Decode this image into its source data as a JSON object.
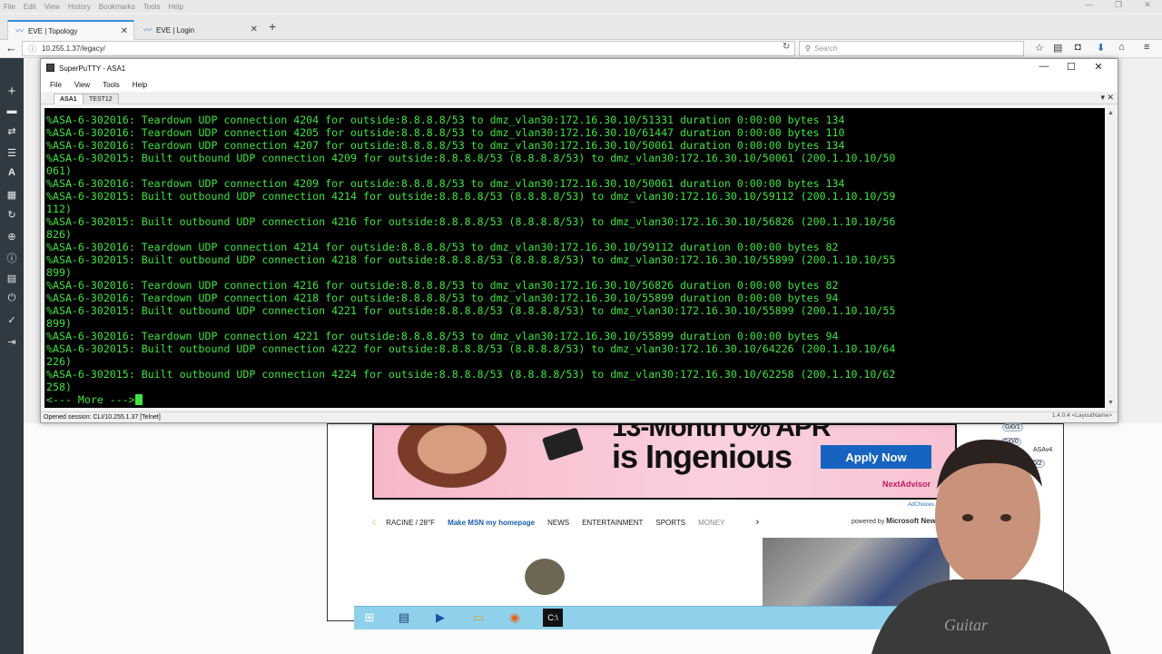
{
  "browser": {
    "menu": [
      "File",
      "Edit",
      "View",
      "History",
      "Bookmarks",
      "Tools",
      "Help"
    ],
    "tabs": [
      {
        "label": "EVE | Topology",
        "active": true
      },
      {
        "label": "EVE | Login",
        "active": false
      }
    ],
    "url": "10.255.1.37/legacy/",
    "search_placeholder": "Search",
    "accent": "#3b8bd6"
  },
  "sidebar": {
    "bg": "#2f3a42",
    "icons": [
      "plus-icon",
      "drive-icon",
      "shuffle-icon",
      "list-icon",
      "text-icon",
      "grid-icon",
      "refresh-icon",
      "zoom-icon",
      "list-alt-icon",
      "power-icon",
      "check-icon",
      "logout-icon"
    ]
  },
  "putty": {
    "title": "SuperPuTTY - ASA1",
    "menu": [
      "File",
      "View",
      "Tools",
      "Help"
    ],
    "tabs": [
      {
        "label": "ASA1",
        "active": true
      },
      {
        "label": "TEST12",
        "active": false
      }
    ],
    "terminal_color": "#3fe33f",
    "terminal_lines": [
      "%ASA-6-302016: Teardown UDP connection 4204 for outside:8.8.8.8/53 to dmz_vlan30:172.16.30.10/51331 duration 0:00:00 bytes 134",
      "%ASA-6-302016: Teardown UDP connection 4205 for outside:8.8.8.8/53 to dmz_vlan30:172.16.30.10/61447 duration 0:00:00 bytes 110",
      "%ASA-6-302016: Teardown UDP connection 4207 for outside:8.8.8.8/53 to dmz_vlan30:172.16.30.10/50061 duration 0:00:00 bytes 134",
      "%ASA-6-302015: Built outbound UDP connection 4209 for outside:8.8.8.8/53 (8.8.8.8/53) to dmz_vlan30:172.16.30.10/50061 (200.1.10.10/50",
      "061)",
      "%ASA-6-302016: Teardown UDP connection 4209 for outside:8.8.8.8/53 to dmz_vlan30:172.16.30.10/50061 duration 0:00:00 bytes 134",
      "%ASA-6-302015: Built outbound UDP connection 4214 for outside:8.8.8.8/53 (8.8.8.8/53) to dmz_vlan30:172.16.30.10/59112 (200.1.10.10/59",
      "112)",
      "%ASA-6-302015: Built outbound UDP connection 4216 for outside:8.8.8.8/53 (8.8.8.8/53) to dmz_vlan30:172.16.30.10/56826 (200.1.10.10/56",
      "826)",
      "%ASA-6-302016: Teardown UDP connection 4214 for outside:8.8.8.8/53 to dmz_vlan30:172.16.30.10/59112 duration 0:00:00 bytes 82",
      "%ASA-6-302015: Built outbound UDP connection 4218 for outside:8.8.8.8/53 (8.8.8.8/53) to dmz_vlan30:172.16.30.10/55899 (200.1.10.10/55",
      "899)",
      "%ASA-6-302016: Teardown UDP connection 4216 for outside:8.8.8.8/53 to dmz_vlan30:172.16.30.10/56826 duration 0:00:00 bytes 82",
      "%ASA-6-302016: Teardown UDP connection 4218 for outside:8.8.8.8/53 to dmz_vlan30:172.16.30.10/55899 duration 0:00:00 bytes 94",
      "%ASA-6-302015: Built outbound UDP connection 4221 for outside:8.8.8.8/53 (8.8.8.8/53) to dmz_vlan30:172.16.30.10/55899 (200.1.10.10/55",
      "899)",
      "%ASA-6-302016: Teardown UDP connection 4221 for outside:8.8.8.8/53 to dmz_vlan30:172.16.30.10/55899 duration 0:00:00 bytes 94",
      "%ASA-6-302015: Built outbound UDP connection 4222 for outside:8.8.8.8/53 (8.8.8.8/53) to dmz_vlan30:172.16.30.10/64226 (200.1.10.10/64",
      "226)",
      "%ASA-6-302015: Built outbound UDP connection 4224 for outside:8.8.8.8/53 (8.8.8.8/53) to dmz_vlan30:172.16.30.10/62258 (200.1.10.10/62",
      "258)"
    ],
    "more_prompt": "<--- More --->",
    "status": "Opened session: CLI/10.255.1.37 [Telnet]",
    "version": "1.4.0.4  <LayoutName>"
  },
  "ad": {
    "headline_top": "13-Month 0% APR",
    "headline_bottom": "is Ingenious",
    "apply_label": "Apply Now",
    "sponsor": "NextAdvisor",
    "adchoices": "AdChoices",
    "button_color": "#1764c0"
  },
  "msn": {
    "location": "RACINE / 28°F",
    "homepage_link": "Make MSN my homepage",
    "nav": [
      "NEWS",
      "ENTERTAINMENT",
      "SPORTS",
      "MONEY"
    ],
    "powered_by": "powered by",
    "powered_brand": "Microsoft News"
  },
  "topology": {
    "labels": [
      "Gi0/1",
      "Gi0/0",
      "ASAv4",
      "Gi0/2"
    ]
  },
  "taskbar": {
    "icons": [
      "windows-start-icon",
      "server-manager-icon",
      "powershell-icon",
      "file-explorer-icon",
      "firefox-icon",
      "cmd-icon"
    ],
    "bg": "#8fd1ea"
  }
}
